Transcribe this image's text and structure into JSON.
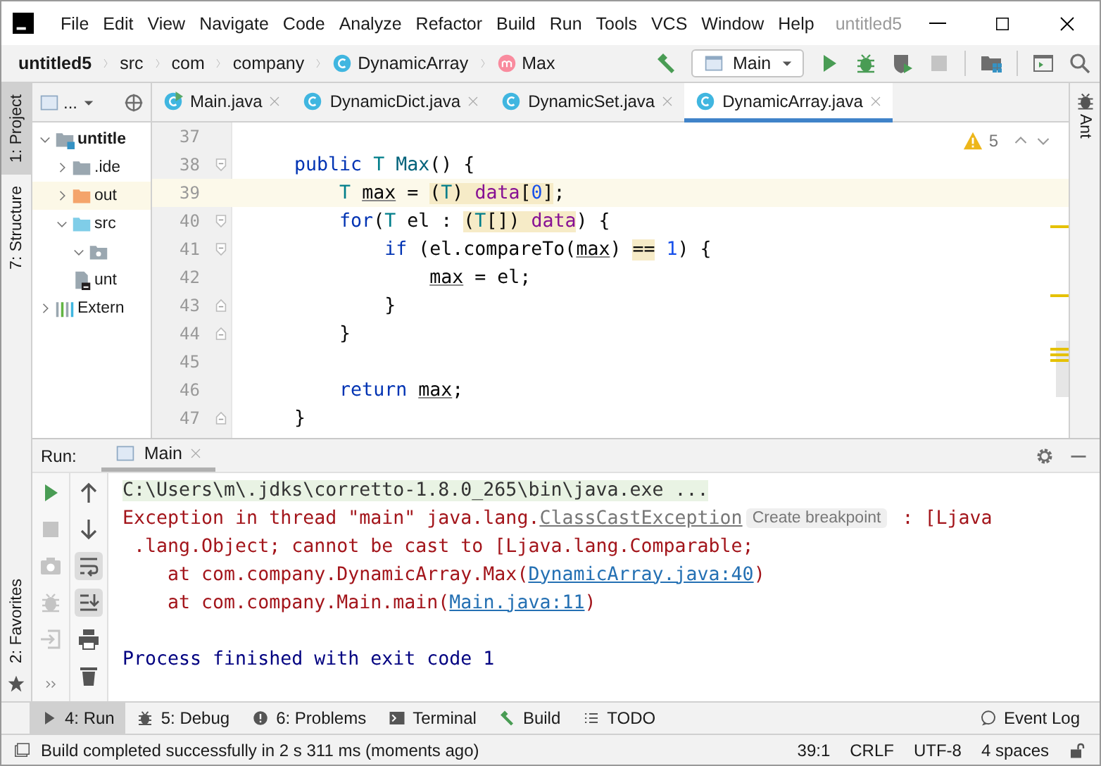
{
  "title_bar": {
    "menus": [
      "File",
      "Edit",
      "View",
      "Navigate",
      "Code",
      "Analyze",
      "Refactor",
      "Build",
      "Run",
      "Tools",
      "VCS",
      "Window",
      "Help"
    ],
    "project_title": "untitled5"
  },
  "nav_bar": {
    "breadcrumbs": [
      {
        "label": "untitled5",
        "kind": "project"
      },
      {
        "label": "src",
        "kind": "folder"
      },
      {
        "label": "com",
        "kind": "folder"
      },
      {
        "label": "company",
        "kind": "folder"
      },
      {
        "label": "DynamicArray",
        "kind": "class"
      },
      {
        "label": "Max",
        "kind": "method"
      }
    ],
    "run_config": "Main"
  },
  "left_strip": {
    "top": [
      {
        "label": "1: Project",
        "selected": true
      },
      {
        "label": "7: Structure",
        "selected": false
      }
    ],
    "bottom": [
      {
        "label": "2: Favorites",
        "selected": false
      }
    ]
  },
  "right_strip": {
    "tabs": [
      "Ant"
    ]
  },
  "project_panel": {
    "title": "...",
    "tree": [
      {
        "label": "untitle",
        "kind": "module",
        "expanded": true,
        "selected": false,
        "children": [
          {
            "label": ".ide",
            "kind": "folder",
            "expanded": false,
            "selected": false
          },
          {
            "label": "out",
            "kind": "excluded",
            "expanded": false,
            "selected": true
          },
          {
            "label": "src",
            "kind": "source",
            "expanded": true,
            "selected": false,
            "children": [
              {
                "kind": "package",
                "expanded": true,
                "selected": false
              }
            ]
          },
          {
            "label": "unt",
            "kind": "file",
            "selected": false
          }
        ]
      },
      {
        "label": "Extern",
        "kind": "libraries",
        "expanded": false,
        "selected": false
      }
    ]
  },
  "editor": {
    "tabs": [
      {
        "label": "Main.java",
        "kind": "runnable",
        "selected": false
      },
      {
        "label": "DynamicDict.java",
        "kind": "class",
        "selected": false
      },
      {
        "label": "DynamicSet.java",
        "kind": "class",
        "selected": false
      },
      {
        "label": "DynamicArray.java",
        "kind": "class",
        "selected": true
      }
    ],
    "warnings": "5",
    "lines": [
      {
        "number": "37",
        "current": false,
        "fold_start": false,
        "fold_end": false
      },
      {
        "number": "38",
        "current": false,
        "fold_start": true,
        "fold_end": false,
        "tokens": [
          {
            "text": "    public",
            "kind": "keyword"
          },
          {
            "text": " T",
            "kind": "type"
          },
          {
            "text": " Max",
            "kind": "method"
          },
          {
            "text": "() {"
          }
        ]
      },
      {
        "number": "39",
        "current": true,
        "fold_start": false,
        "fold_end": false,
        "tokens": [
          {
            "text": "        T",
            "kind": "type"
          },
          {
            "text": " max",
            "kind": "local"
          },
          {
            "text": " = "
          },
          {
            "kind": "highlight",
            "tokens": [
              {
                "text": "("
              },
              {
                "text": "T",
                "kind": "type"
              },
              {
                "text": ") "
              },
              {
                "text": "data",
                "kind": "field"
              },
              {
                "text": "["
              },
              {
                "text": "0",
                "kind": "number"
              },
              {
                "text": "]"
              }
            ]
          },
          {
            "text": ";"
          }
        ]
      },
      {
        "number": "40",
        "current": false,
        "fold_start": true,
        "fold_end": false,
        "tokens": [
          {
            "text": "        for",
            "kind": "keyword"
          },
          {
            "text": "("
          },
          {
            "text": "T",
            "kind": "type"
          },
          {
            "text": " el : "
          },
          {
            "kind": "highlight",
            "tokens": [
              {
                "text": "("
              },
              {
                "text": "T",
                "kind": "type"
              },
              {
                "text": "[]) "
              },
              {
                "text": "data",
                "kind": "field"
              }
            ]
          },
          {
            "text": ") {"
          }
        ]
      },
      {
        "number": "41",
        "current": false,
        "fold_start": true,
        "fold_end": false,
        "tokens": [
          {
            "text": "            if",
            "kind": "keyword"
          },
          {
            "text": " (el.compareTo("
          },
          {
            "text": "max",
            "kind": "local"
          },
          {
            "text": ") "
          },
          {
            "kind": "highlight",
            "tokens": [
              {
                "text": "=="
              }
            ]
          },
          {
            "text": " 1",
            "kind": "number"
          },
          {
            "text": ") {"
          }
        ]
      },
      {
        "number": "42",
        "current": false,
        "fold_start": false,
        "fold_end": false,
        "tokens": [
          {
            "text": "                max",
            "kind": "local"
          },
          {
            "text": " = el;"
          }
        ]
      },
      {
        "number": "43",
        "current": false,
        "fold_start": false,
        "fold_end": true,
        "tokens": [
          {
            "text": "            }"
          }
        ]
      },
      {
        "number": "44",
        "current": false,
        "fold_start": false,
        "fold_end": true,
        "tokens": [
          {
            "text": "        }"
          }
        ]
      },
      {
        "number": "45",
        "current": false,
        "fold_start": false,
        "fold_end": false
      },
      {
        "number": "46",
        "current": false,
        "fold_start": false,
        "fold_end": false,
        "tokens": [
          {
            "text": "        return",
            "kind": "keyword"
          },
          {
            "text": " max",
            "kind": "local"
          },
          {
            "text": ";"
          }
        ]
      },
      {
        "number": "47",
        "current": false,
        "fold_start": false,
        "fold_end": true,
        "tokens": [
          {
            "text": "    }"
          }
        ]
      }
    ]
  },
  "run_panel": {
    "label": "Run:",
    "tab": "Main",
    "actions": [
      {
        "kind": "rerun",
        "disabled": false
      },
      {
        "kind": "stop",
        "disabled": true
      },
      {
        "kind": "camera",
        "disabled": true
      },
      {
        "kind": "debug",
        "disabled": true
      },
      {
        "kind": "exit",
        "disabled": true
      }
    ],
    "toggles": [
      {
        "kind": "up",
        "on": false
      },
      {
        "kind": "down",
        "on": false
      },
      {
        "kind": "wrap",
        "on": true
      },
      {
        "kind": "scroll-end",
        "on": true
      },
      {
        "kind": "print",
        "on": false
      },
      {
        "kind": "trash",
        "on": false
      }
    ],
    "console": [
      {
        "kind": "output",
        "segments": [
          {
            "text": "C:\\Users\\m\\.jdks\\corretto-1.8.0_265\\bin\\java.exe ...",
            "kind": "command"
          }
        ]
      },
      {
        "kind": "output",
        "segments": [
          {
            "text": "Exception in thread \"main\" java.lang.",
            "kind": "error"
          },
          {
            "text": "ClassCastException",
            "kind": "exception-link"
          },
          {
            "text": "Create breakpoint",
            "kind": "hint"
          },
          {
            "text": " : [Ljava",
            "kind": "error"
          }
        ]
      },
      {
        "kind": "output",
        "segments": [
          {
            "text": " .lang.Object; cannot be cast to [Ljava.lang.Comparable;",
            "kind": "error"
          }
        ]
      },
      {
        "kind": "output",
        "segments": [
          {
            "text": "    at com.company.DynamicArray.Max(",
            "kind": "error"
          },
          {
            "text": "DynamicArray.java:40",
            "kind": "link"
          },
          {
            "text": ")",
            "kind": "error"
          }
        ]
      },
      {
        "kind": "output",
        "segments": [
          {
            "text": "    at com.company.Main.main(",
            "kind": "error"
          },
          {
            "text": "Main.java:11",
            "kind": "link"
          },
          {
            "text": ")",
            "kind": "error"
          }
        ]
      },
      {
        "kind": "exit",
        "segments": [
          {
            "text": "Process finished with exit code 1",
            "kind": "info"
          }
        ]
      }
    ]
  },
  "tool_bar": {
    "tools": [
      {
        "label": "4: Run",
        "kind": "run",
        "selected": true
      },
      {
        "label": "5: Debug",
        "kind": "debug",
        "selected": false
      },
      {
        "label": "6: Problems",
        "kind": "problems",
        "selected": false
      },
      {
        "label": "Terminal",
        "kind": "terminal",
        "selected": false
      },
      {
        "label": "Build",
        "kind": "build",
        "selected": false
      },
      {
        "label": "TODO",
        "kind": "todo",
        "selected": false
      }
    ],
    "event_log": "Event Log"
  },
  "status_bar": {
    "message": "Build completed successfully in 2 s 311 ms (moments ago)",
    "position": "39:1",
    "line_separator": "CRLF",
    "encoding": "UTF-8",
    "indent": "4 spaces"
  }
}
